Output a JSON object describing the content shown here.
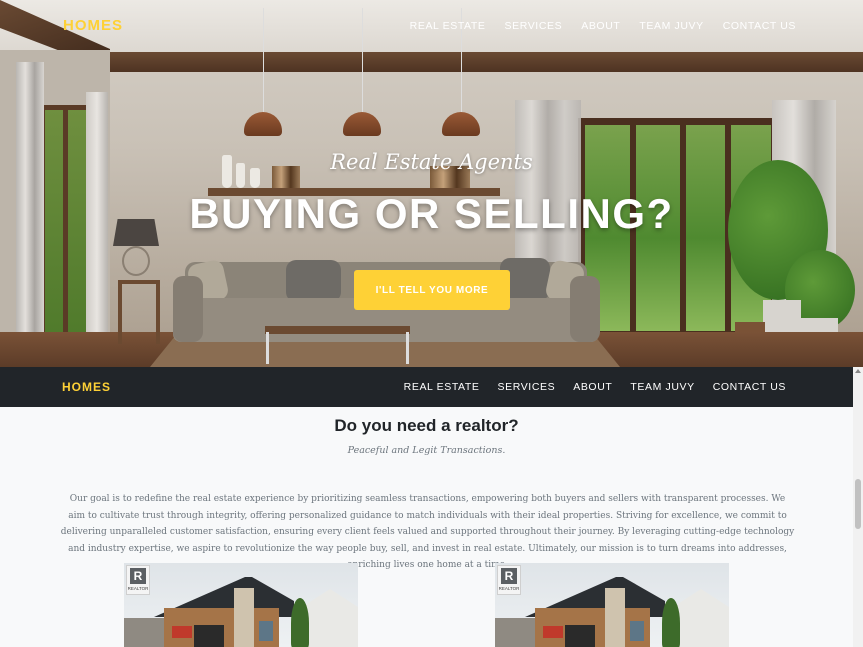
{
  "brand": "HOMES",
  "nav": {
    "items": [
      {
        "label": "REAL ESTATE"
      },
      {
        "label": "SERVICES"
      },
      {
        "label": "ABOUT"
      },
      {
        "label": "TEAM JUVY"
      },
      {
        "label": "CONTACT US"
      }
    ]
  },
  "hero": {
    "subheading": "Real Estate Agents",
    "heading": "BUYING OR SELLING?",
    "button_label": "I'LL TELL YOU MORE"
  },
  "section": {
    "title": "Do you need a realtor?",
    "subtitle": "Peaceful and Legit Transactions.",
    "mission": "Our goal is to redefine the real estate experience by prioritizing seamless transactions, empowering both buyers and sellers with transparent processes. We aim to cultivate trust through integrity, offering personalized guidance to match individuals with their ideal properties. Striving for excellence, we commit to delivering unparalleled customer satisfaction, ensuring every client feels valued and supported throughout their journey. By leveraging cutting-edge technology and industry expertise, we aspire to revolutionize the way people buy, sell, and invest in real estate. Ultimately, our mission is to turn dreams into addresses, enriching lives one home at a time."
  },
  "listings": [
    {
      "logo_letter": "R",
      "logo_text": "REALTOR"
    },
    {
      "logo_letter": "R",
      "logo_text": "REALTOR"
    }
  ],
  "colors": {
    "accent": "#fed136",
    "dark_nav": "#212529",
    "text_muted": "#6c757d",
    "heading": "#212529"
  }
}
